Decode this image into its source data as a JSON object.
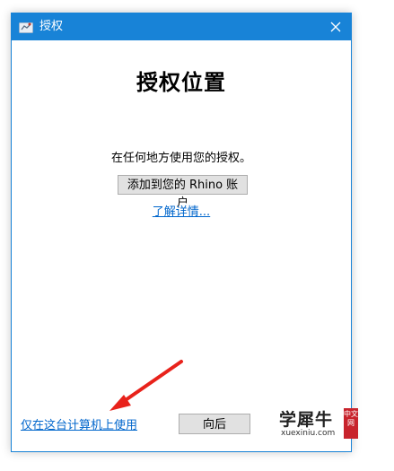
{
  "window": {
    "title": "授权",
    "close_symbol": "✕",
    "icons": {
      "app": "rhino-app-icon",
      "close": "close-icon"
    },
    "accent_color": "#1883d7"
  },
  "main": {
    "heading": "授权位置",
    "description": "在任何地方使用您的授权。",
    "add_button_label": "添加到您的 Rhino 账户",
    "learn_more_link": "了解详情...",
    "local_link": "仅在这台计算机上使用",
    "back_button_label": "向后",
    "link_color": "#0066cc"
  },
  "annotation": {
    "arrow_color": "#e8221b"
  },
  "watermark": {
    "main_text": "学犀牛",
    "sub_text": "xuexiniu.com",
    "stamp_text": "中文网"
  }
}
